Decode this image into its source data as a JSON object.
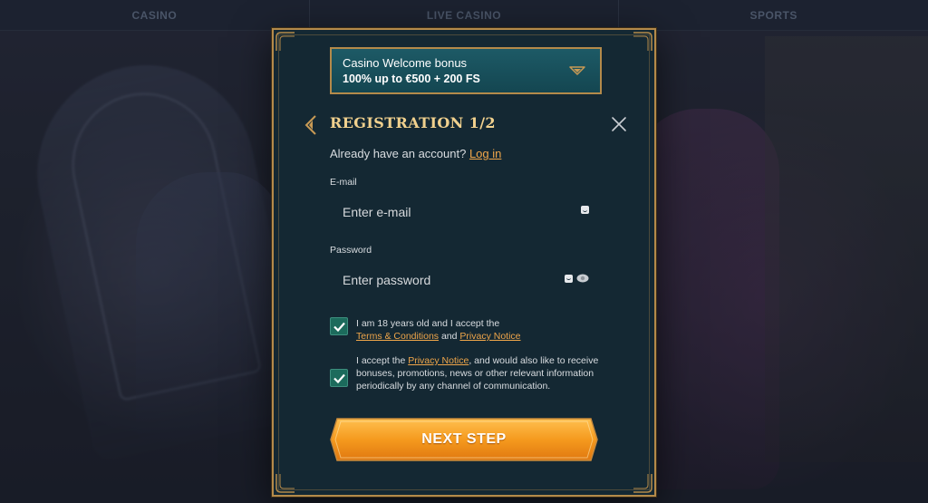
{
  "nav": {
    "items": [
      {
        "label": "CASINO"
      },
      {
        "label": "LIVE CASINO"
      },
      {
        "label": "SPORTS"
      }
    ]
  },
  "bonus": {
    "title": "Casino Welcome bonus",
    "amount": "100% up to €500 + 200 FS"
  },
  "registration": {
    "title": "Registration 1/2",
    "account_text": "Already have an account?",
    "login_link": "Log in"
  },
  "email": {
    "label": "E-mail",
    "placeholder": "Enter e-mail",
    "value": ""
  },
  "password": {
    "label": "Password",
    "placeholder": "Enter password",
    "value": ""
  },
  "consent_age": {
    "checked": true,
    "prefix": "I am 18 years old and I accept the",
    "terms_link": "Terms & Conditions",
    "and_text": "and",
    "privacy_link": "Privacy Notice"
  },
  "consent_marketing": {
    "checked": true,
    "prefix": "I accept the",
    "privacy_link": "Privacy Notice",
    "suffix": ", and would also like to receive bonuses, promotions, news or other relevant information periodically by any channel of communication."
  },
  "next_button": {
    "label": "NEXT STEP"
  },
  "colors": {
    "modal_bg": "#142833",
    "gold_border": "#b48a4a",
    "title_gold": "#f1d18e",
    "link_orange": "#f0a64a",
    "checkbox_green": "#1c6b5c",
    "button_orange": "#f39a1c"
  },
  "icons": {
    "back": "chevron-left-icon",
    "close": "close-icon",
    "dropdown": "chevron-down-icon",
    "eye": "eye-icon",
    "check": "check-icon"
  }
}
